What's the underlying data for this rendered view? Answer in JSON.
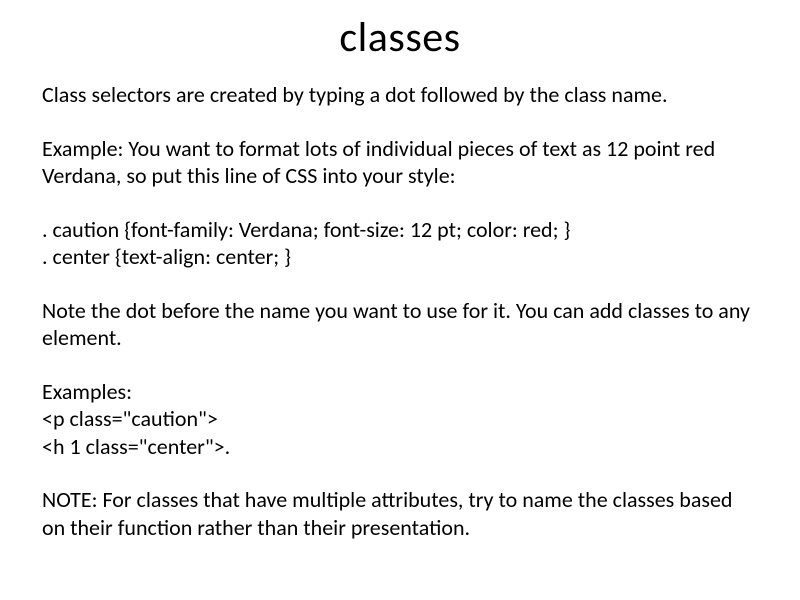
{
  "title": "classes",
  "paragraphs": {
    "p1": "Class selectors are created by typing a dot followed by the class name.",
    "p2": "Example: You want to format lots of individual pieces of text as 12 point red Verdana, so put this line of CSS into your style:",
    "p3a": ". caution {font-family: Verdana; font-size: 12 pt; color: red; }",
    "p3b": ". center {text-align: center; }",
    "p4": "Note the dot before the name you want to use for it. You can add classes to any element.",
    "p5a": "Examples:",
    "p5b": "<p class=\"caution\">",
    "p5c": "<h 1 class=\"center\">.",
    "p6": "NOTE: For classes that have multiple attributes, try to name the classes based on their function rather than their presentation."
  }
}
